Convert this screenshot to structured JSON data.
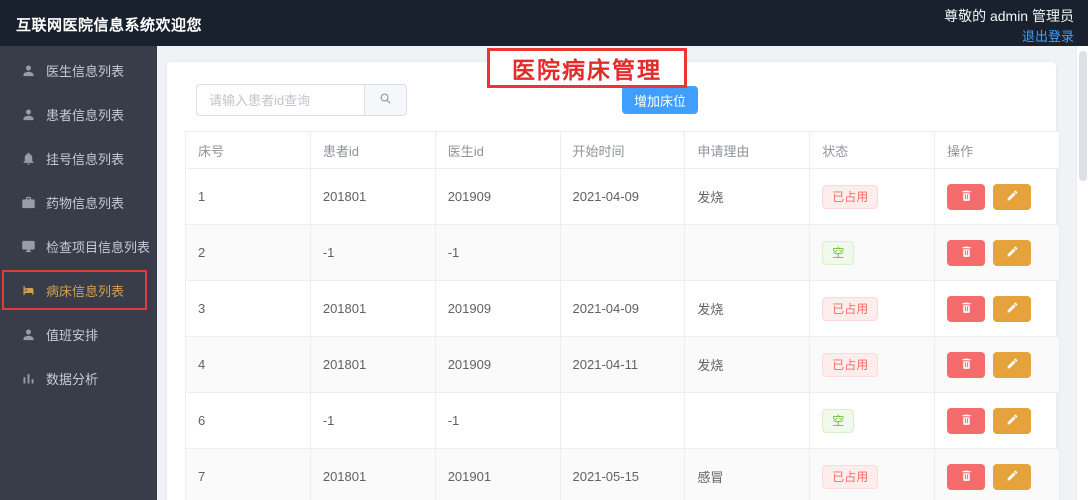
{
  "header": {
    "title": "互联网医院信息系统欢迎您",
    "user_greeting": "尊敬的 admin 管理员",
    "logout_label": "退出登录"
  },
  "sidebar": {
    "items": [
      {
        "label": "医生信息列表",
        "icon": "doctor-user",
        "glyph": "user",
        "active": false
      },
      {
        "label": "患者信息列表",
        "icon": "patient-user",
        "glyph": "user",
        "active": false
      },
      {
        "label": "挂号信息列表",
        "icon": "bell",
        "glyph": "bell",
        "active": false
      },
      {
        "label": "药物信息列表",
        "icon": "medicine-case",
        "glyph": "briefcase",
        "active": false
      },
      {
        "label": "检查项目信息列表",
        "icon": "monitor",
        "glyph": "monitor",
        "active": false
      },
      {
        "label": "病床信息列表",
        "icon": "bed",
        "glyph": "bed",
        "active": true
      },
      {
        "label": "值班安排",
        "icon": "duty-user",
        "glyph": "user",
        "active": false
      },
      {
        "label": "数据分析",
        "icon": "bar-chart",
        "glyph": "chart",
        "active": false
      }
    ]
  },
  "main": {
    "page_title": "医院病床管理",
    "search": {
      "placeholder": "请输入患者id查询",
      "value": "",
      "icon": "search"
    },
    "add_button_label": "增加床位",
    "table": {
      "columns": [
        "床号",
        "患者id",
        "医生id",
        "开始时间",
        "申请理由",
        "状态",
        "操作"
      ],
      "rows": [
        {
          "bed": "1",
          "patient_id": "201801",
          "doctor_id": "201909",
          "start": "2021-04-09",
          "reason": "发烧",
          "status": "已占用",
          "status_type": "occupied"
        },
        {
          "bed": "2",
          "patient_id": "-1",
          "doctor_id": "-1",
          "start": "",
          "reason": "",
          "status": "空",
          "status_type": "empty"
        },
        {
          "bed": "3",
          "patient_id": "201801",
          "doctor_id": "201909",
          "start": "2021-04-09",
          "reason": "发烧",
          "status": "已占用",
          "status_type": "occupied"
        },
        {
          "bed": "4",
          "patient_id": "201801",
          "doctor_id": "201909",
          "start": "2021-04-11",
          "reason": "发烧",
          "status": "已占用",
          "status_type": "occupied"
        },
        {
          "bed": "6",
          "patient_id": "-1",
          "doctor_id": "-1",
          "start": "",
          "reason": "",
          "status": "空",
          "status_type": "empty"
        },
        {
          "bed": "7",
          "patient_id": "201801",
          "doctor_id": "201901",
          "start": "2021-05-15",
          "reason": "感冒",
          "status": "已占用",
          "status_type": "occupied"
        }
      ],
      "action_buttons": [
        {
          "name": "delete",
          "icon": "trash"
        },
        {
          "name": "edit",
          "icon": "pen"
        }
      ]
    }
  },
  "colors": {
    "primary": "#409eff",
    "danger": "#f56c6c",
    "warning": "#e6a23c",
    "success": "#67c23a",
    "annotation_red": "#ec3535",
    "header_bg": "#1a212e",
    "sidebar_bg": "#393d49",
    "sidebar_active": "#d3a24f"
  }
}
